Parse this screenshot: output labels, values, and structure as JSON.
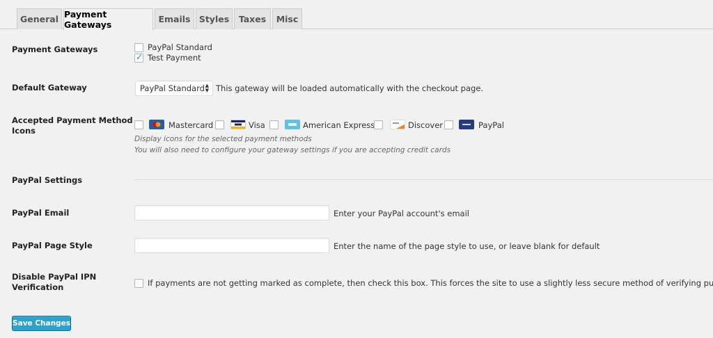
{
  "tabs": [
    {
      "label": "General"
    },
    {
      "label": "Payment Gateways"
    },
    {
      "label": "Emails"
    },
    {
      "label": "Styles"
    },
    {
      "label": "Taxes"
    },
    {
      "label": "Misc"
    }
  ],
  "active_tab": "Payment Gateways",
  "payment_gateways": {
    "label": "Payment Gateways",
    "options": [
      {
        "label": "PayPal Standard",
        "checked": false
      },
      {
        "label": "Test Payment",
        "checked": true
      }
    ]
  },
  "default_gateway": {
    "label": "Default Gateway",
    "selected": "PayPal Standard",
    "description": "This gateway will be loaded automatically with the checkout page."
  },
  "accepted_icons": {
    "label_line1": "Accepted Payment Method",
    "label_line2": "Icons",
    "cards": [
      {
        "label": "Mastercard",
        "icon": "mastercard-icon",
        "checked": false
      },
      {
        "label": "Visa",
        "icon": "visa-icon",
        "checked": false
      },
      {
        "label": "American Express",
        "icon": "amex-icon",
        "checked": false
      },
      {
        "label": "Discover",
        "icon": "discover-icon",
        "checked": false
      },
      {
        "label": "PayPal",
        "icon": "paypal-icon",
        "checked": false
      }
    ],
    "desc1": "Display icons for the selected payment methods",
    "desc2": "You will also need to configure your gateway settings if you are accepting credit cards"
  },
  "paypal_settings": {
    "heading": "PayPal Settings"
  },
  "paypal_email": {
    "label": "PayPal Email",
    "value": "",
    "description": "Enter your PayPal account's email"
  },
  "paypal_page_style": {
    "label": "PayPal Page Style",
    "value": "",
    "description": "Enter the name of the page style to use, or leave blank for default"
  },
  "disable_ipn": {
    "label_line1": "Disable PayPal IPN",
    "label_line2": "Verification",
    "checked": false,
    "description": "If payments are not getting marked as complete, then check this box. This forces the site to use a slightly less secure method of verifying purchases."
  },
  "save_button": "Save Changes",
  "colors": {
    "primary_button": "#2ea2cc",
    "checkbox_tick": "#1e8cbe",
    "background": "#f1f1f1"
  }
}
